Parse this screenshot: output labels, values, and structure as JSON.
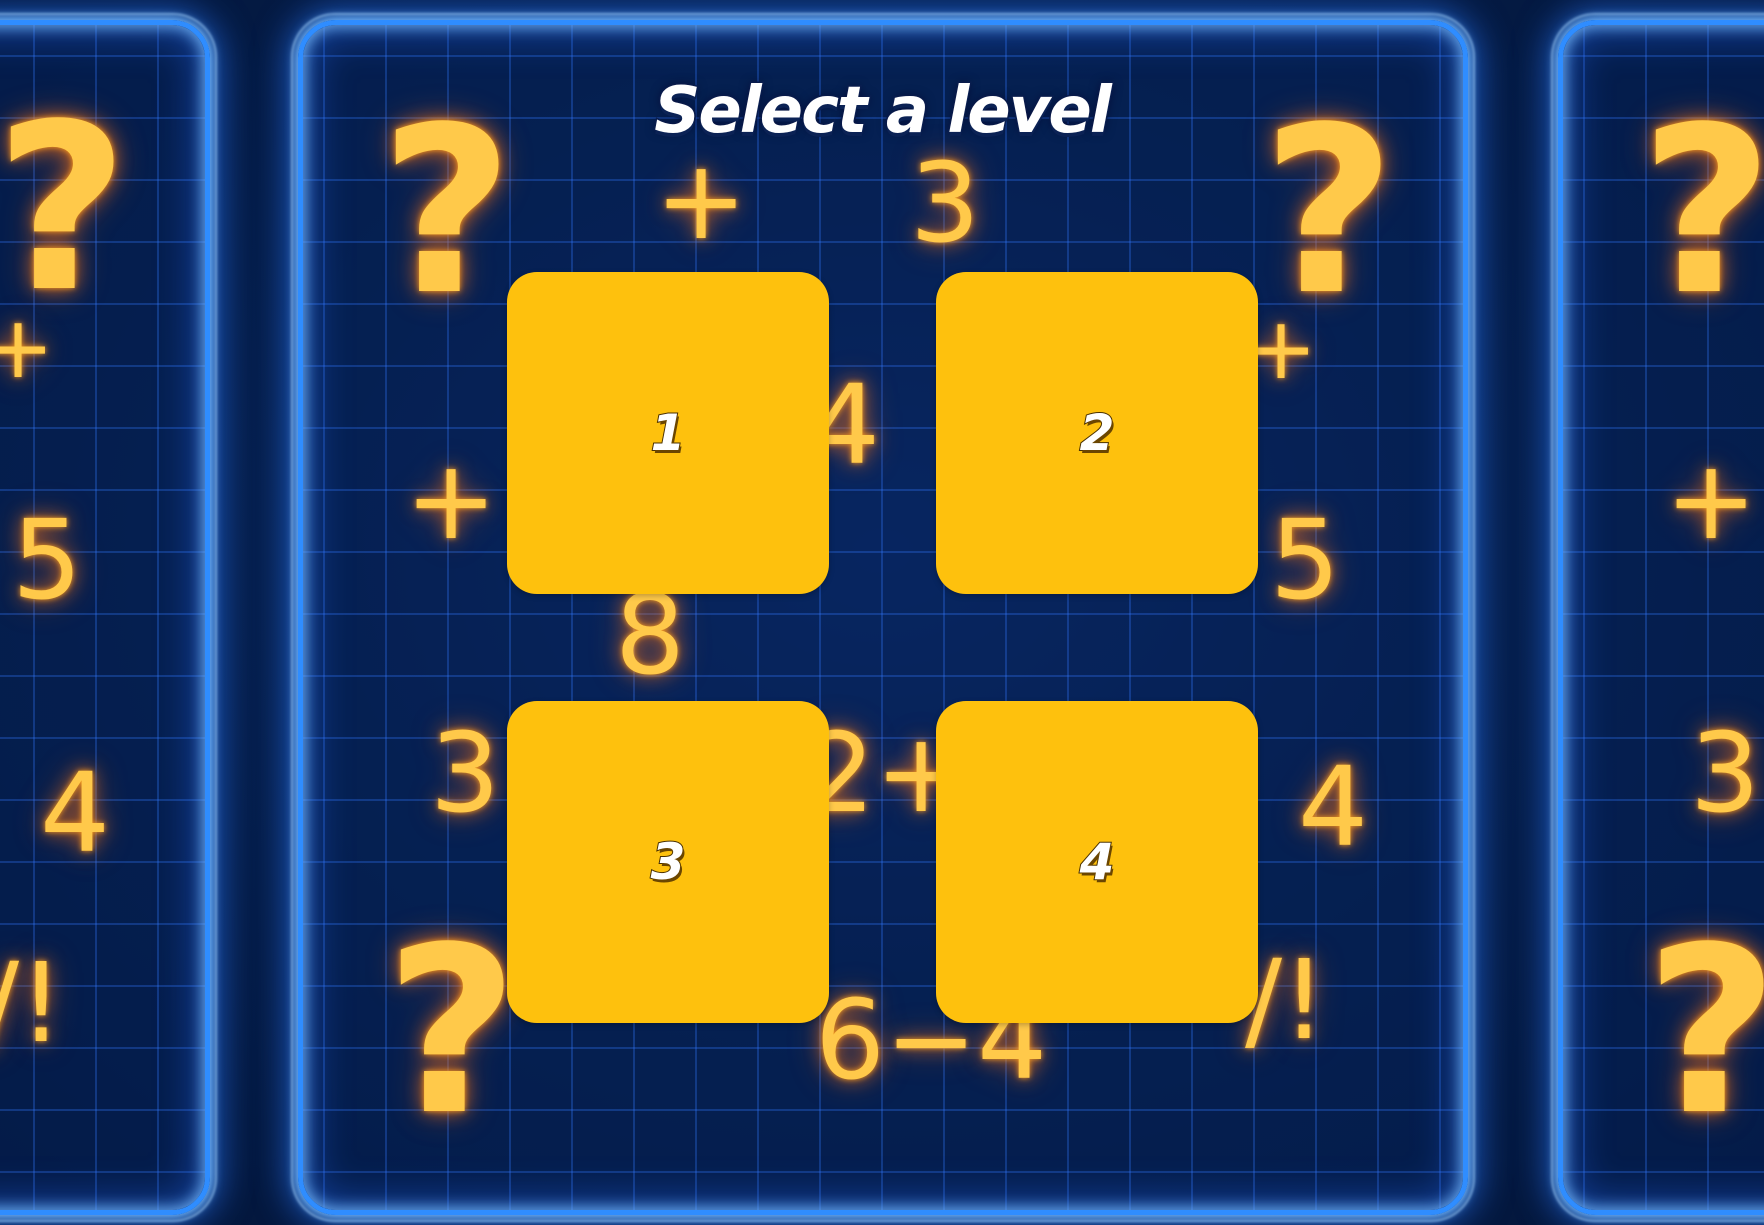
{
  "screen": {
    "title": "Select a level"
  },
  "levels": [
    {
      "label": "1"
    },
    {
      "label": "2"
    },
    {
      "label": "3"
    },
    {
      "label": "4"
    }
  ],
  "background": {
    "glyph_color": "#ffc94a",
    "electric_border_color": "#2f8dff",
    "tile_color": "#fec10d",
    "glyphs": {
      "q_left_top": "?",
      "q_left_bottom": "?",
      "plus_left": "+",
      "five_left": "5",
      "four_left": "4",
      "q_center_tl": "?",
      "plus_top": "+",
      "three_top": "3",
      "q_center_tr": "?",
      "plus_center_left": "+",
      "four_mid": "4",
      "five_center_right": "5",
      "eight": "8",
      "three_center_left": "3",
      "two_plus": "2+",
      "four_center_right": "4",
      "q_center_bl": "?",
      "six_minus_four": "6−4",
      "excl_center_right": "/!",
      "q_right_top": "?",
      "plus_right": "+",
      "three_right": "3",
      "q_right_bottom": "?",
      "excl_left": "/!",
      "plus_small_left": "+",
      "plus_small_right": "+"
    }
  }
}
